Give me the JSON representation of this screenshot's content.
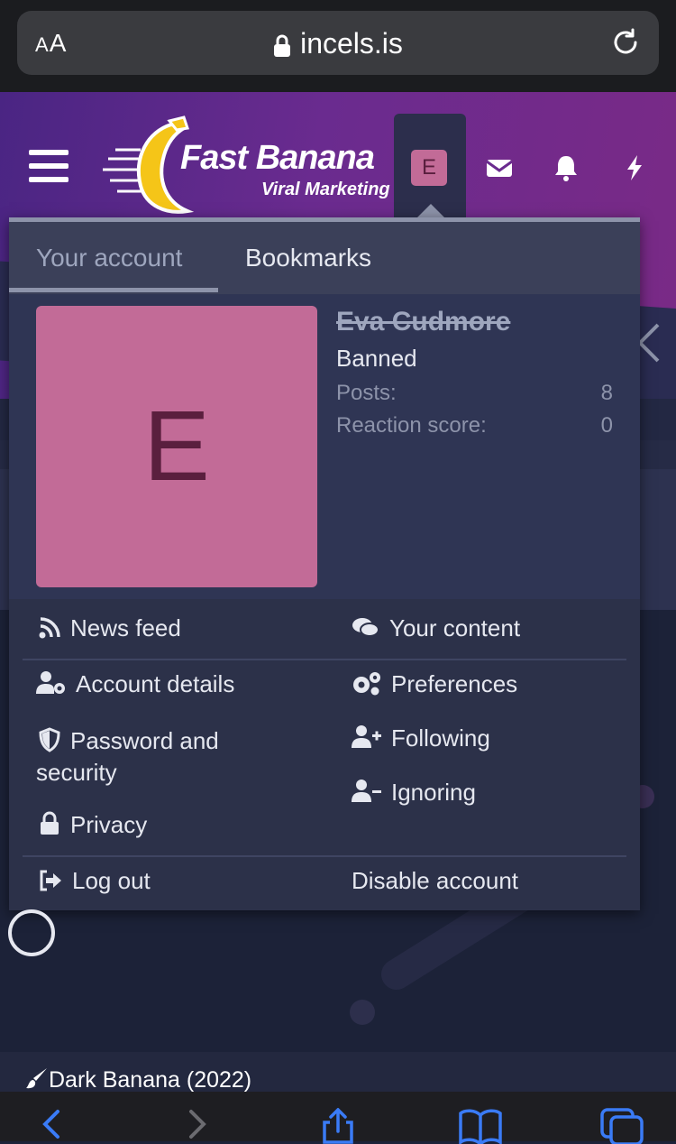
{
  "browser": {
    "text_size_label": "AA",
    "url": "incels.is"
  },
  "header": {
    "logo_title": "Fast Banana",
    "logo_subtitle": "Viral Marketing",
    "avatar_letter": "E",
    "icons": [
      "menu-icon",
      "envelope-icon",
      "bell-icon",
      "bolt-icon"
    ]
  },
  "account_panel": {
    "tabs": [
      "Your account",
      "Bookmarks"
    ],
    "active_tab": "Your account",
    "user": {
      "avatar_letter": "E",
      "name": "Eva Cudmore",
      "status": "Banned",
      "stats": [
        {
          "label": "Posts:",
          "value": "8"
        },
        {
          "label": "Reaction score:",
          "value": "0"
        }
      ]
    },
    "menu": {
      "news_feed": "News feed",
      "your_content": "Your content",
      "account_details": "Account details",
      "preferences": "Preferences",
      "password_security_line1": "Password and",
      "password_security_line2": "security",
      "following": "Following",
      "ignoring": "Ignoring",
      "privacy": "Privacy",
      "log_out": "Log out",
      "disable_account": "Disable account"
    }
  },
  "footer": {
    "style_name": "Dark Banana (2022)"
  },
  "colors": {
    "avatar": "#c26b97",
    "avatar_letter": "#5a1f3e",
    "panel": "#2c3149",
    "header_gradient_start": "#4a2583",
    "header_gradient_end": "#7a2a86"
  }
}
